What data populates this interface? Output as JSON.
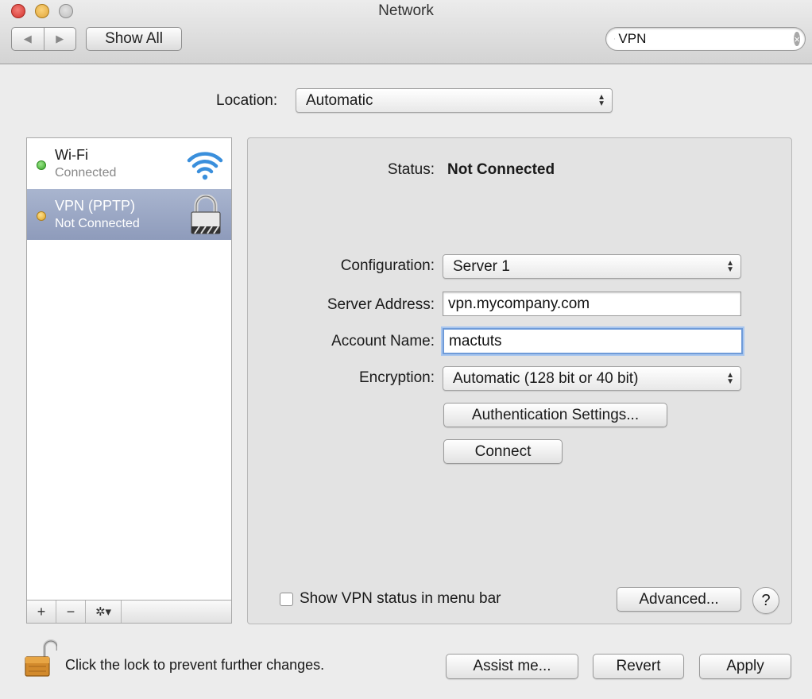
{
  "window": {
    "title": "Network"
  },
  "toolbar": {
    "back_glyph": "◀",
    "forward_glyph": "▶",
    "show_all_label": "Show All",
    "search_value": "VPN",
    "search_clear_glyph": "×"
  },
  "location": {
    "label": "Location:",
    "value": "Automatic"
  },
  "services": [
    {
      "name": "Wi-Fi",
      "status": "Connected",
      "dot_color": "#4bbf3a",
      "icon": "wifi-icon"
    },
    {
      "name": "VPN (PPTP)",
      "status": "Not Connected",
      "dot_color": "#e6b73a",
      "icon": "lock-icon",
      "selected": true
    }
  ],
  "list_toolbar": {
    "add": "+",
    "remove": "−",
    "gear": "✲▾"
  },
  "details": {
    "status_label": "Status:",
    "status_value": "Not Connected",
    "configuration_label": "Configuration:",
    "configuration_value": "Server 1",
    "server_label": "Server Address:",
    "server_value": "vpn.mycompany.com",
    "account_label": "Account Name:",
    "account_value": "mactuts",
    "encryption_label": "Encryption:",
    "encryption_value": "Automatic (128 bit or 40 bit)",
    "auth_button": "Authentication Settings...",
    "connect_button": "Connect",
    "show_status_label": "Show VPN status in menu bar",
    "show_status_checked": false,
    "advanced_button": "Advanced...",
    "help_button": "?"
  },
  "footer": {
    "lock_text": "Click the lock to prevent further changes.",
    "assist_button": "Assist me...",
    "revert_button": "Revert",
    "apply_button": "Apply"
  },
  "colors": {
    "selection": "#8e9bbb",
    "focus_ring": "#6f9bd8"
  }
}
